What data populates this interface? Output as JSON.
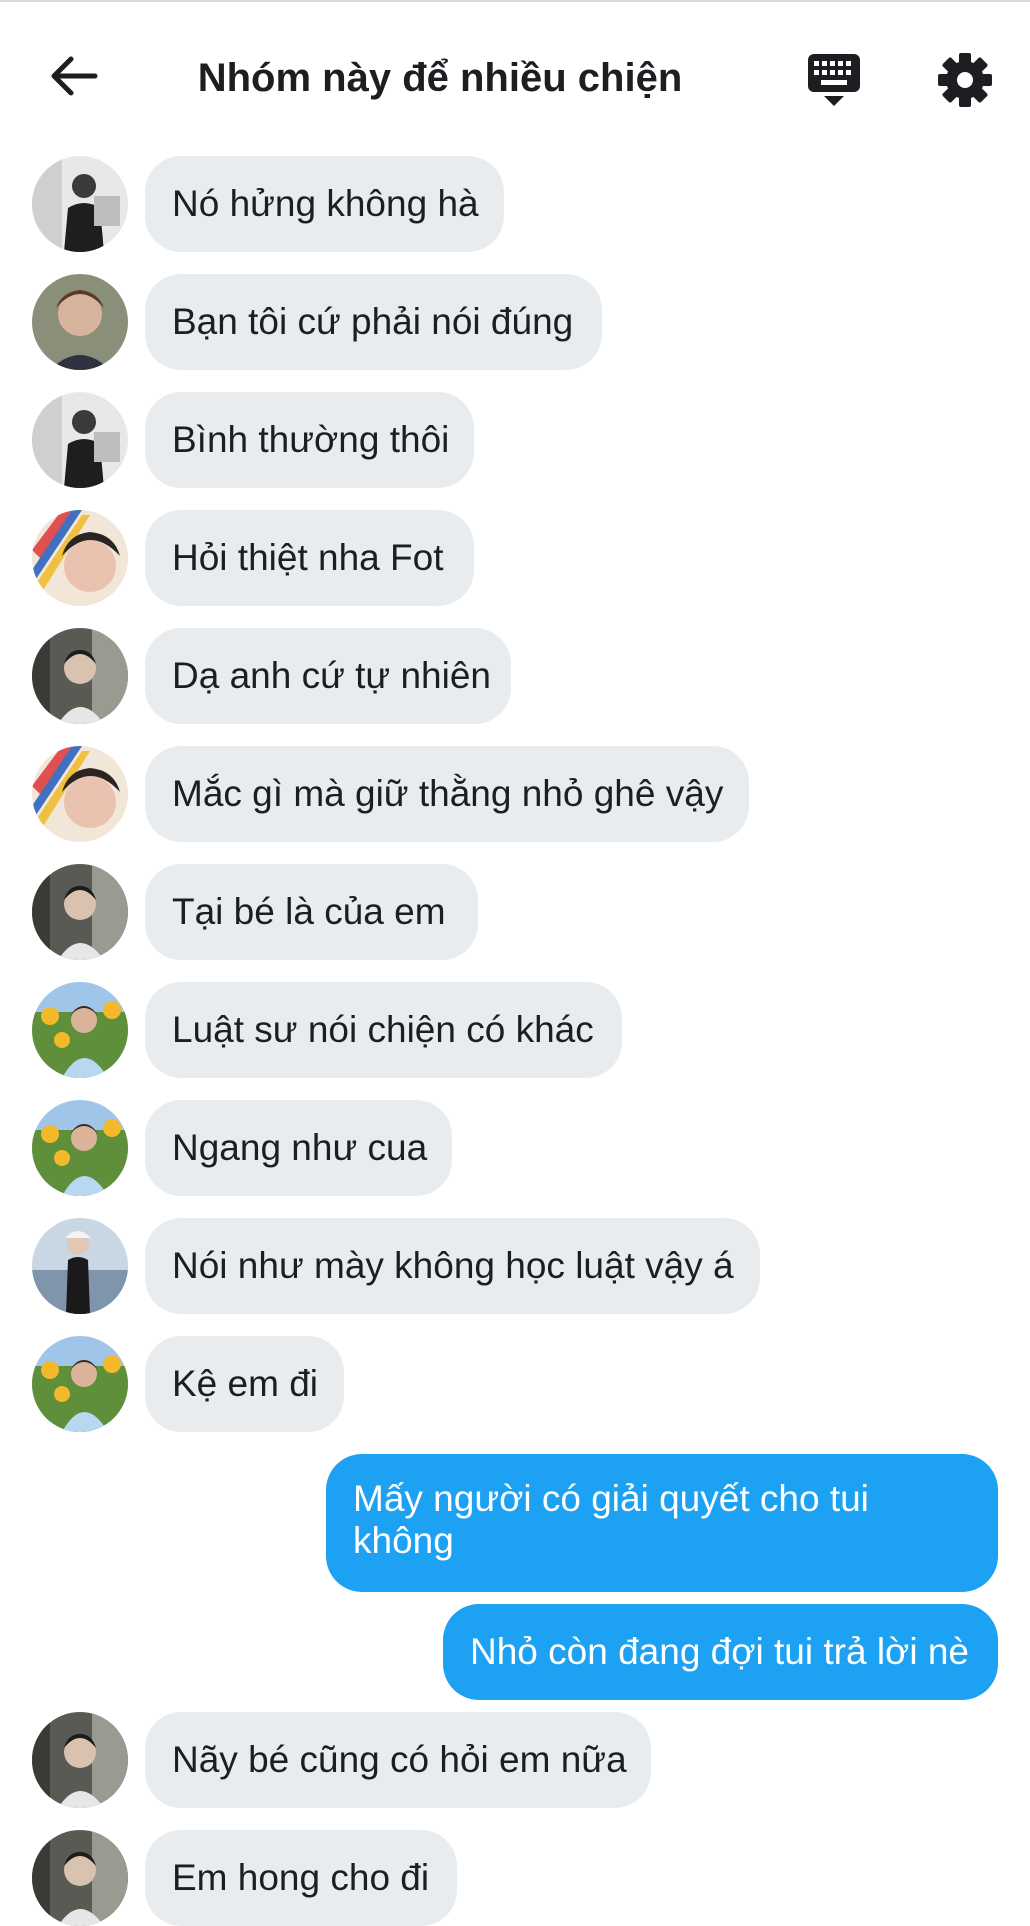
{
  "header": {
    "title": "Nhóm này để nhiều chiện"
  },
  "icons": {
    "back": "arrow-left-icon",
    "keyboard": "keyboard-icon",
    "settings": "gear-icon"
  },
  "colors": {
    "incoming_bubble": "#e9ecef",
    "outgoing_bubble": "#1da1f2",
    "text": "#1c1e21"
  },
  "messages": [
    {
      "direction": "in",
      "avatar": "user-a",
      "text": "Nó hửng không hà"
    },
    {
      "direction": "in",
      "avatar": "user-b",
      "text": "Bạn tôi cứ phải nói đúng"
    },
    {
      "direction": "in",
      "avatar": "user-a",
      "text": "Bình thường thôi"
    },
    {
      "direction": "in",
      "avatar": "user-c",
      "text": "Hỏi thiệt nha Fot"
    },
    {
      "direction": "in",
      "avatar": "user-d",
      "text": "Dạ anh cứ tự nhiên"
    },
    {
      "direction": "in",
      "avatar": "user-c",
      "text": "Mắc gì mà giữ thằng nhỏ ghê vậy"
    },
    {
      "direction": "in",
      "avatar": "user-d",
      "text": "Tại bé là của em"
    },
    {
      "direction": "in",
      "avatar": "user-e",
      "text": "Luật sư nói chiện có khác"
    },
    {
      "direction": "in",
      "avatar": "user-e",
      "text": "Ngang như cua"
    },
    {
      "direction": "in",
      "avatar": "user-f",
      "text": "Nói như mày không học luật vậy á"
    },
    {
      "direction": "in",
      "avatar": "user-e",
      "text": "Kệ em đi"
    },
    {
      "direction": "out",
      "text": "Mấy người có giải quyết cho tui không"
    },
    {
      "direction": "out",
      "text": "Nhỏ còn đang đợi tui trả lời nè"
    },
    {
      "direction": "in",
      "avatar": "user-d",
      "text": "Nãy bé cũng có hỏi em nữa"
    },
    {
      "direction": "in",
      "avatar": "user-d",
      "text": "Em hong cho đi"
    }
  ]
}
